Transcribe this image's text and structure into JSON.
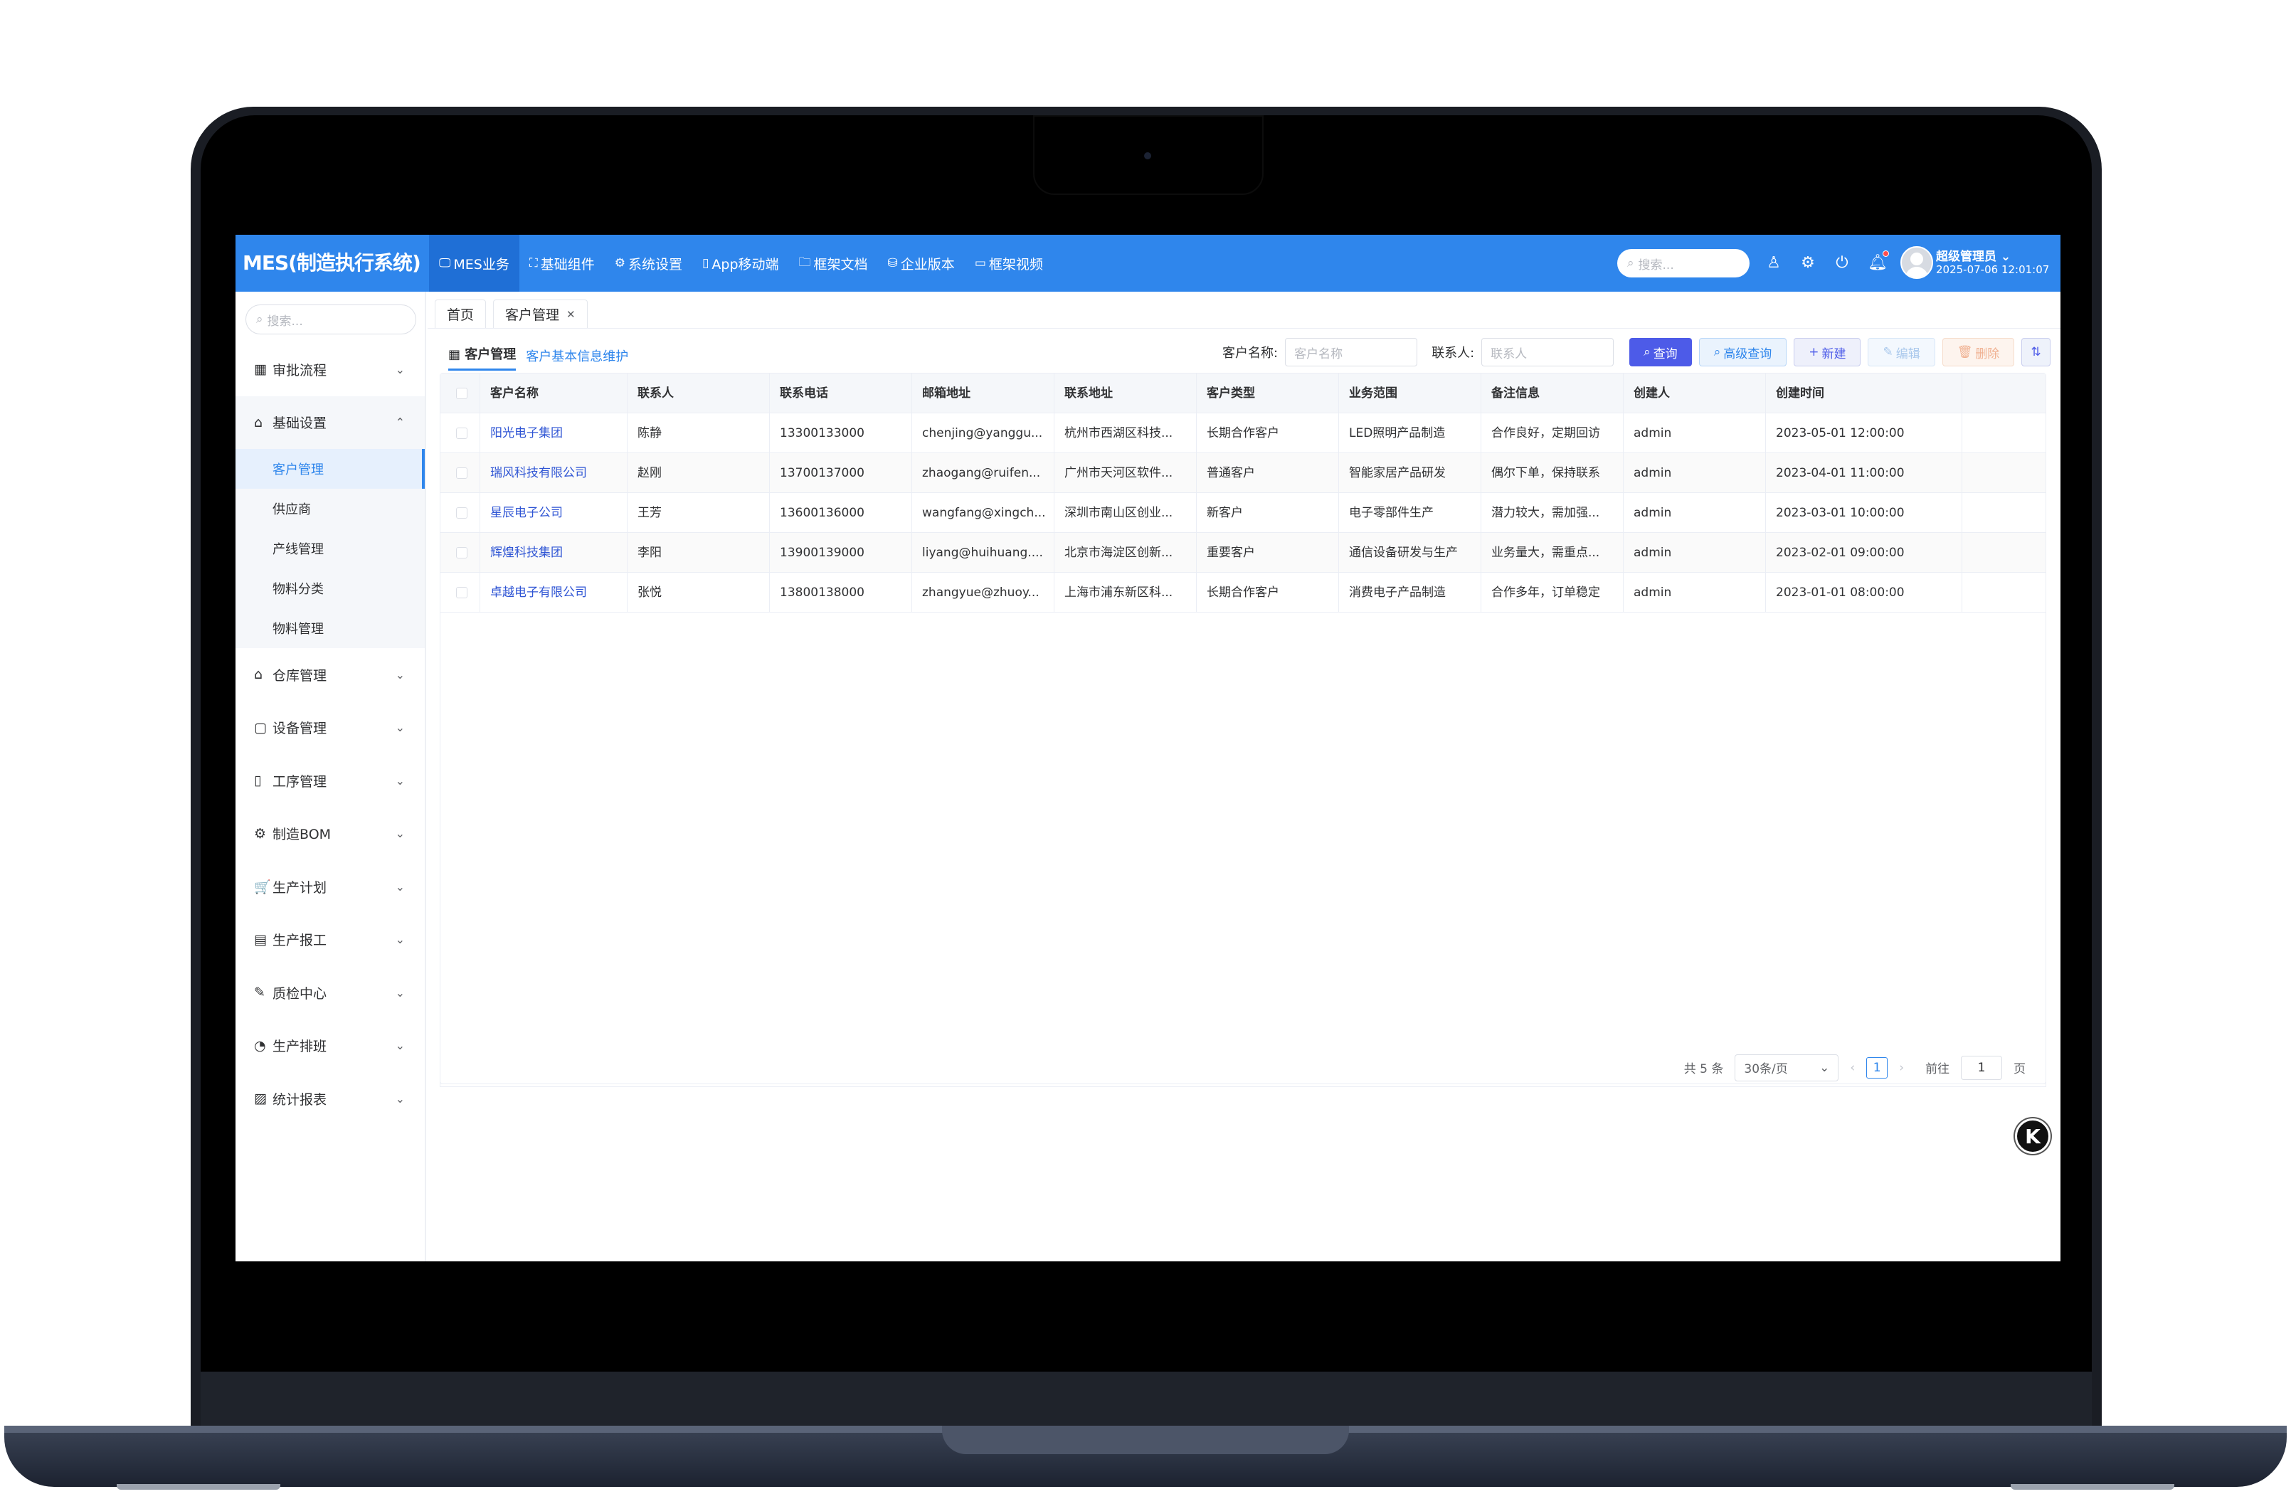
{
  "header": {
    "brand": "MES(制造执行系统)",
    "nav": [
      {
        "icon": "monitor-icon",
        "glyph": "🖵",
        "label": "MES业务"
      },
      {
        "icon": "component-icon",
        "glyph": "⛶",
        "label": "基础组件"
      },
      {
        "icon": "gear-icon",
        "glyph": "⚙",
        "label": "系统设置"
      },
      {
        "icon": "mobile-icon",
        "glyph": "▯",
        "label": "App移动端"
      },
      {
        "icon": "folder-icon",
        "glyph": "🗀",
        "label": "框架文档"
      },
      {
        "icon": "database-icon",
        "glyph": "⛁",
        "label": "企业版本"
      },
      {
        "icon": "video-icon",
        "glyph": "▭",
        "label": "框架视频"
      }
    ],
    "search_placeholder": "搜索...",
    "user_name": "超级管理员",
    "user_time": "2025-07-06 12:01:07"
  },
  "sidebar": {
    "search_placeholder": "搜索...",
    "items": [
      {
        "icon": "calendar-icon",
        "glyph": "▦",
        "label": "审批流程",
        "open": false
      },
      {
        "icon": "settings-box-icon",
        "glyph": "⌂",
        "label": "基础设置",
        "open": true,
        "children": [
          "客户管理",
          "供应商",
          "产线管理",
          "物料分类",
          "物料管理"
        ]
      },
      {
        "icon": "house-icon",
        "glyph": "⌂",
        "label": "仓库管理",
        "open": false
      },
      {
        "icon": "device-icon",
        "glyph": "▢",
        "label": "设备管理",
        "open": false
      },
      {
        "icon": "tablet-icon",
        "glyph": "▯",
        "label": "工序管理",
        "open": false
      },
      {
        "icon": "gear-icon",
        "glyph": "⚙",
        "label": "制造BOM",
        "open": false
      },
      {
        "icon": "cart-icon",
        "glyph": "🛒",
        "label": "生产计划",
        "open": false
      },
      {
        "icon": "report-icon",
        "glyph": "▤",
        "label": "生产报工",
        "open": false
      },
      {
        "icon": "edit-icon",
        "glyph": "✎",
        "label": "质检中心",
        "open": false
      },
      {
        "icon": "compass-icon",
        "glyph": "◔",
        "label": "生产排班",
        "open": false
      },
      {
        "icon": "chart-icon",
        "glyph": "▨",
        "label": "统计报表",
        "open": false
      }
    ]
  },
  "tabs": [
    {
      "label": "首页",
      "closable": false
    },
    {
      "label": "客户管理",
      "closable": true
    }
  ],
  "content": {
    "subtabs": [
      "客户管理",
      "客户基本信息维护"
    ],
    "filters": {
      "name_label": "客户名称:",
      "name_placeholder": "客户名称",
      "contact_label": "联系人:",
      "contact_placeholder": "联系人"
    },
    "buttons": {
      "query": "查询",
      "advanced": "高级查询",
      "new": "新建",
      "edit": "编辑",
      "delete": "删除"
    },
    "table": {
      "columns": [
        "",
        "客户名称",
        "联系人",
        "联系电话",
        "邮箱地址",
        "联系地址",
        "客户类型",
        "业务范围",
        "备注信息",
        "创建人",
        "创建时间"
      ],
      "rows": [
        [
          "",
          "阳光电子集团",
          "陈静",
          "13300133000",
          "chenjing@yanggu...",
          "杭州市西湖区科技...",
          "长期合作客户",
          "LED照明产品制造",
          "合作良好，定期回访",
          "admin",
          "2023-05-01 12:00:00"
        ],
        [
          "",
          "瑞风科技有限公司",
          "赵刚",
          "13700137000",
          "zhaogang@ruifen...",
          "广州市天河区软件...",
          "普通客户",
          "智能家居产品研发",
          "偶尔下单，保持联系",
          "admin",
          "2023-04-01 11:00:00"
        ],
        [
          "",
          "星辰电子公司",
          "王芳",
          "13600136000",
          "wangfang@xingch...",
          "深圳市南山区创业...",
          "新客户",
          "电子零部件生产",
          "潜力较大，需加强...",
          "admin",
          "2023-03-01 10:00:00"
        ],
        [
          "",
          "辉煌科技集团",
          "李阳",
          "13900139000",
          "liyang@huihuang....",
          "北京市海淀区创新...",
          "重要客户",
          "通信设备研发与生产",
          "业务量大，需重点...",
          "admin",
          "2023-02-01 09:00:00"
        ],
        [
          "",
          "卓越电子有限公司",
          "张悦",
          "13800138000",
          "zhangyue@zhuoy...",
          "上海市浦东新区科...",
          "长期合作客户",
          "消费电子产品制造",
          "合作多年，订单稳定",
          "admin",
          "2023-01-01 08:00:00"
        ]
      ]
    },
    "pagination": {
      "total": "共 5 条",
      "page_size": "30条/页",
      "current": "1",
      "goto_label": "前往",
      "goto_value": "1",
      "page_suffix": "页"
    }
  },
  "fab_label": "K",
  "colors": {
    "header": "#2f86ec",
    "primary": "#4d5be8",
    "link": "#2f55d4"
  }
}
